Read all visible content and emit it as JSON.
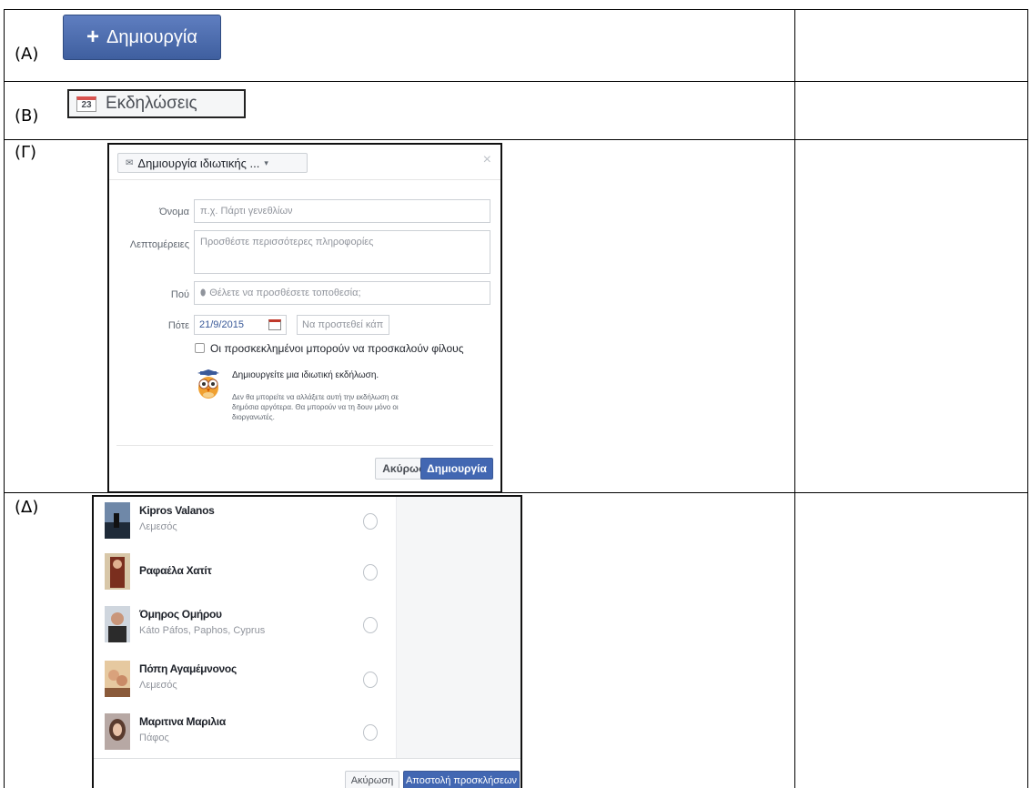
{
  "rows": {
    "a": {
      "label": "(A)"
    },
    "b": {
      "label": "(B)"
    },
    "c": {
      "label": "(Γ)"
    },
    "d": {
      "label": "(Δ)"
    }
  },
  "create_button": {
    "icon": "plus-icon",
    "label": "Δημιουργία"
  },
  "events_button": {
    "icon": "calendar-icon",
    "calendar_day": "23",
    "label": "Εκδηλώσεις"
  },
  "dialog": {
    "privacy_dropdown": {
      "icon": "envelope-icon",
      "label": "Δημιουργία ιδιωτικής ...",
      "caret": "▾"
    },
    "close": "×",
    "name": {
      "label": "Όνομα",
      "placeholder": "π.χ. Πάρτι γενεθλίων"
    },
    "details": {
      "label": "Λεπτομέρειες",
      "placeholder": "Προσθέστε περισσότερες πληροφορίες"
    },
    "where": {
      "label": "Πού",
      "placeholder": "Θέλετε να προσθέσετε τοποθεσία;"
    },
    "when": {
      "label": "Πότε",
      "date": "21/9/2015",
      "time_placeholder": "Να προστεθεί κάπ"
    },
    "guests_invite_checkbox": {
      "label": "Οι προσκεκλημένοι μπορούν να προσκαλούν φίλους",
      "checked": false
    },
    "notice": {
      "icon": "owl-icon",
      "title": "Δημιουργείτε μια ιδιωτική εκδήλωση.",
      "body": "Δεν θα μπορείτε να αλλάξετε αυτή την εκδήλωση σε δημόσια αργότερα. Θα μπορούν να τη δουν μόνο οι διοργανωτές."
    },
    "cancel_label": "Ακύρωση",
    "create_label": "Δημιουργία"
  },
  "invite_list": {
    "people": [
      {
        "name": "Kipros Valanos",
        "location": "Λεμεσός"
      },
      {
        "name": "Ραφαέλα Χατίτ",
        "location": ""
      },
      {
        "name": "Όμηρος Ομήρου",
        "location": "Káto Páfos, Paphos, Cyprus"
      },
      {
        "name": "Πόπη Αγαμέμνονος",
        "location": "Λεμεσός"
      },
      {
        "name": "Μαριτινα Μαριλια",
        "location": "Πάφος"
      }
    ],
    "cancel_label": "Ακύρωση",
    "send_label": "Αποστολή προσκλήσεων"
  }
}
